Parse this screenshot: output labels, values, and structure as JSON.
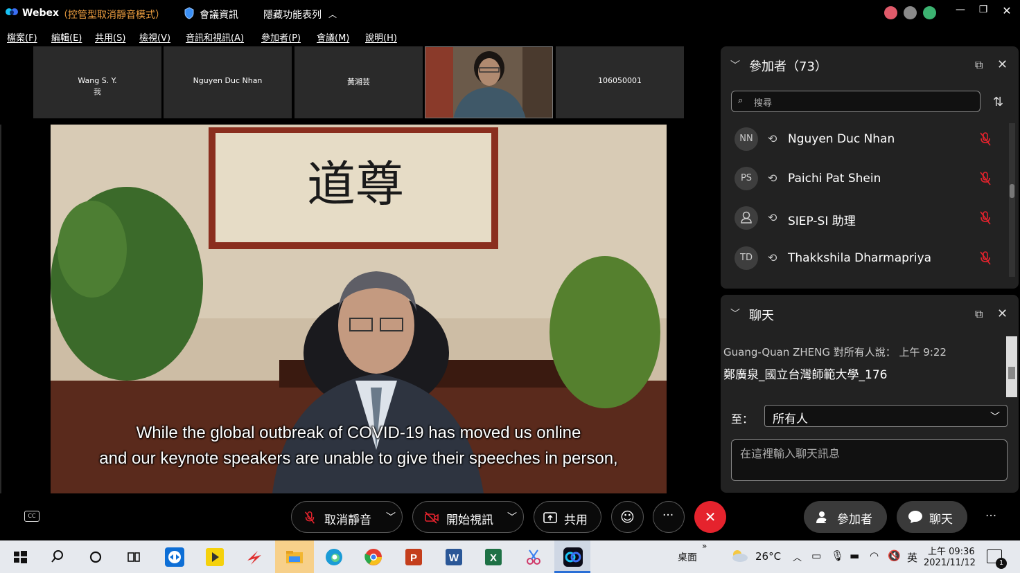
{
  "titlebar": {
    "app_name": "Webex",
    "mode": "（控管型取消靜音模式）",
    "meeting_info": "會議資訊",
    "hide_toolbar": "隱藏功能表列"
  },
  "menu": [
    "檔案(F)",
    "編輯(E)",
    "共用(S)",
    "檢視(V)",
    "音訊和視訊(A)",
    "參加者(P)",
    "會議(M)",
    "說明(H)"
  ],
  "tiles": [
    {
      "name": "Wang S. Y.",
      "sub": "我"
    },
    {
      "name": "Nguyen Duc Nhan",
      "sub": ""
    },
    {
      "name": "黃湘芸",
      "sub": ""
    },
    {
      "name": "",
      "sub": ""
    },
    {
      "name": "106050001",
      "sub": ""
    }
  ],
  "main_video": {
    "caption_line1": "While the global outbreak of COVID-19 has moved us online",
    "caption_line2": "and our keynote speakers are unable to give their speeches in person,"
  },
  "participants_panel": {
    "title": "參加者（73）",
    "search_placeholder": "搜尋",
    "list": [
      {
        "initials": "NN",
        "name": "Nguyen Duc Nhan"
      },
      {
        "initials": "PS",
        "name": "Paichi Pat Shein"
      },
      {
        "initials": "",
        "name": "SIEP-SI 助理"
      },
      {
        "initials": "TD",
        "name": "Thakkshila Dharmapriya"
      }
    ]
  },
  "chat_panel": {
    "title": "聊天",
    "sender": "Guang-Quan ZHENG 對所有人說：   上午 9:22",
    "message": "鄭廣泉_國立台灣師範大學_176",
    "to_label": "至：",
    "to_value": "所有人",
    "input_placeholder": "在這裡輸入聊天訊息"
  },
  "controls": {
    "unmute": "取消靜音",
    "start_video": "開始視訊",
    "share": "共用",
    "more": "···",
    "participants": "參加者",
    "chat": "聊天",
    "overflow": "···"
  },
  "taskbar": {
    "desktop": "桌面",
    "temperature": "26°C",
    "ime": "英",
    "time": "上午 09:36",
    "date": "2021/11/12",
    "notification_count": "1"
  },
  "colors": {
    "mode_orange": "#f0a040",
    "leave_red": "#e5232d",
    "panel_bg": "#222222"
  }
}
